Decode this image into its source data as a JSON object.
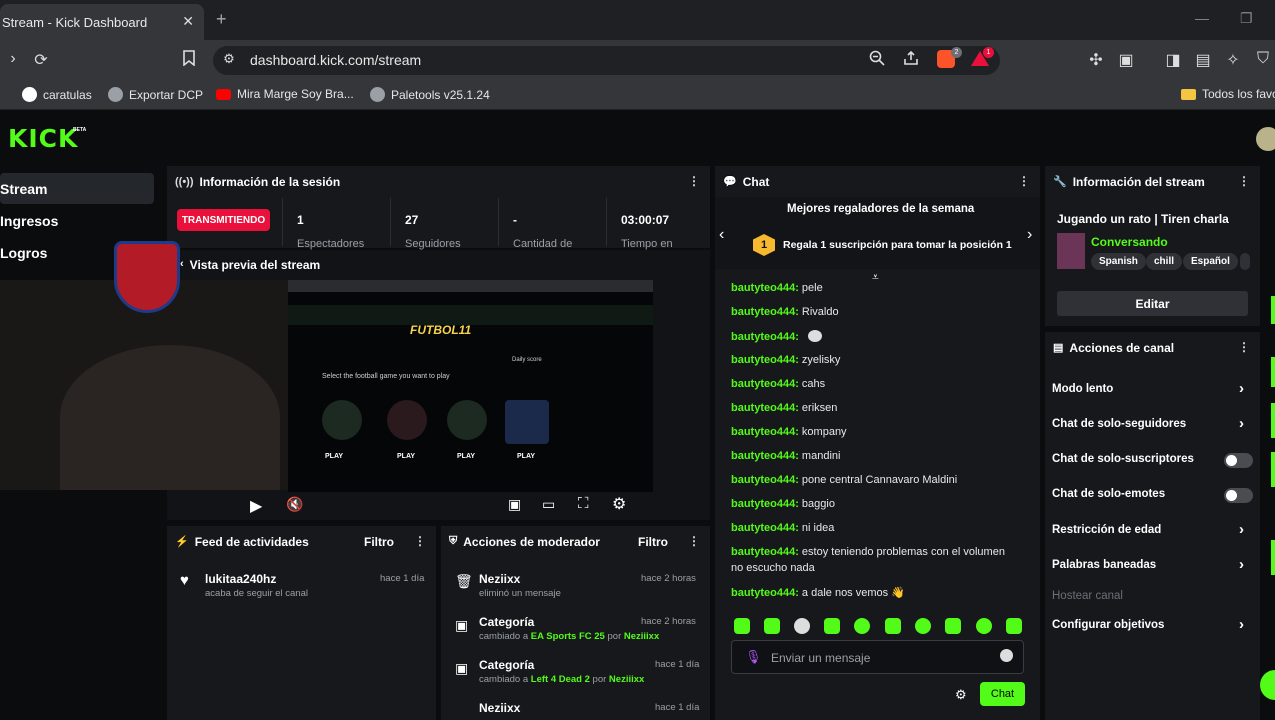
{
  "browser": {
    "tab_title": "Stream - Kick Dashboard",
    "tab_close": "✕",
    "new_tab": "+",
    "url": "dashboard.kick.com/stream",
    "brave_badge": "2",
    "alert_badge": "1",
    "bookmarks": [
      "caratulas",
      "Exportar DCP",
      "Mira Marge Soy Bra...",
      "Paletools v25.1.24"
    ],
    "bookmarks_right": "Todos los favo"
  },
  "app": {
    "logo": "KICK",
    "beta": "BETA",
    "sidebar": [
      "Stream",
      "Ingresos",
      "Logros"
    ]
  },
  "session": {
    "title": "Información de la sesión",
    "status": "TRANSMITIENDO",
    "stats": [
      {
        "value": "1",
        "label": "Espectadores"
      },
      {
        "value": "27",
        "label": "Seguidores"
      },
      {
        "value": "-",
        "label": "Cantidad de"
      },
      {
        "value": "03:00:07",
        "label": "Tiempo en"
      }
    ]
  },
  "preview": {
    "title": "Vista previa del stream",
    "site_title": "FUTBOL11",
    "site_subtitle": "Select the football game you want to play",
    "daily": "Daily score",
    "play": "PLAY"
  },
  "chat": {
    "title": "Chat",
    "gifters_title": "Mejores regaladores de la semana",
    "gifters_rank": "1",
    "gifters_text": "Regala 1 suscripción para tomar la posición 1",
    "messages": [
      {
        "user": "bautyteo444:",
        "text": "pele"
      },
      {
        "user": "bautyteo444:",
        "text": "Rivaldo"
      },
      {
        "user": "bautyteo444:",
        "text": ""
      },
      {
        "user": "bautyteo444:",
        "text": "zyelisky"
      },
      {
        "user": "bautyteo444:",
        "text": "cahs"
      },
      {
        "user": "bautyteo444:",
        "text": "eriksen"
      },
      {
        "user": "bautyteo444:",
        "text": "kompany"
      },
      {
        "user": "bautyteo444:",
        "text": "mandini"
      },
      {
        "user": "bautyteo444:",
        "text": "pone central Cannavaro Maldini"
      },
      {
        "user": "bautyteo444:",
        "text": "baggio"
      },
      {
        "user": "bautyteo444:",
        "text": "ni idea"
      },
      {
        "user": "bautyteo444:",
        "text": "estoy teniendo problemas con el volumen"
      },
      {
        "user": "",
        "text": "no escucho nada"
      },
      {
        "user": "bautyteo444:",
        "text": "a dale nos vemos 👋"
      }
    ],
    "input_placeholder": "Enviar un mensaje",
    "send": "Chat"
  },
  "stream_info": {
    "title": "Información del stream",
    "stream_title": "Jugando un rato | Tiren charla",
    "category": "Conversando",
    "tags": [
      "Spanish",
      "chill",
      "Español"
    ],
    "edit": "Editar"
  },
  "channel_actions": {
    "title": "Acciones de canal",
    "items": [
      {
        "label": "Modo lento",
        "control": "chevron"
      },
      {
        "label": "Chat de solo-seguidores",
        "control": "chevron"
      },
      {
        "label": "Chat de solo-suscriptores",
        "control": "toggle"
      },
      {
        "label": "Chat de solo-emotes",
        "control": "toggle"
      },
      {
        "label": "Restricción de edad",
        "control": "chevron"
      },
      {
        "label": "Palabras baneadas",
        "control": "chevron"
      },
      {
        "label": "Hostear canal",
        "control": "none"
      },
      {
        "label": "Configurar objetivos",
        "control": "chevron"
      }
    ]
  },
  "feed": {
    "title": "Feed de actividades",
    "filter": "Filtro",
    "items": [
      {
        "name": "lukitaa240hz",
        "desc": "acaba de seguir el canal",
        "time": "hace 1 día"
      }
    ]
  },
  "moderator": {
    "title": "Acciones de moderador",
    "filter": "Filtro",
    "items": [
      {
        "name": "Neziixx",
        "pre": "eliminó un mensaje",
        "target": "",
        "mid": "",
        "by": "",
        "time": "hace 2 horas"
      },
      {
        "name": "Categoría",
        "pre": "cambiado a ",
        "target": "EA Sports FC 25",
        "mid": " por ",
        "by": "Neziiixx",
        "time": "hace 2 horas"
      },
      {
        "name": "Categoría",
        "pre": "cambiado a ",
        "target": "Left 4 Dead 2",
        "mid": " por ",
        "by": "Neziiixx",
        "time": "hace 1 día"
      },
      {
        "name": "Neziixx",
        "pre": "",
        "target": "",
        "mid": "",
        "by": "",
        "time": "hace 1 día"
      }
    ]
  },
  "colors": {
    "accent": "#53fc18",
    "live": "#e9113c",
    "panel": "#17181c"
  }
}
